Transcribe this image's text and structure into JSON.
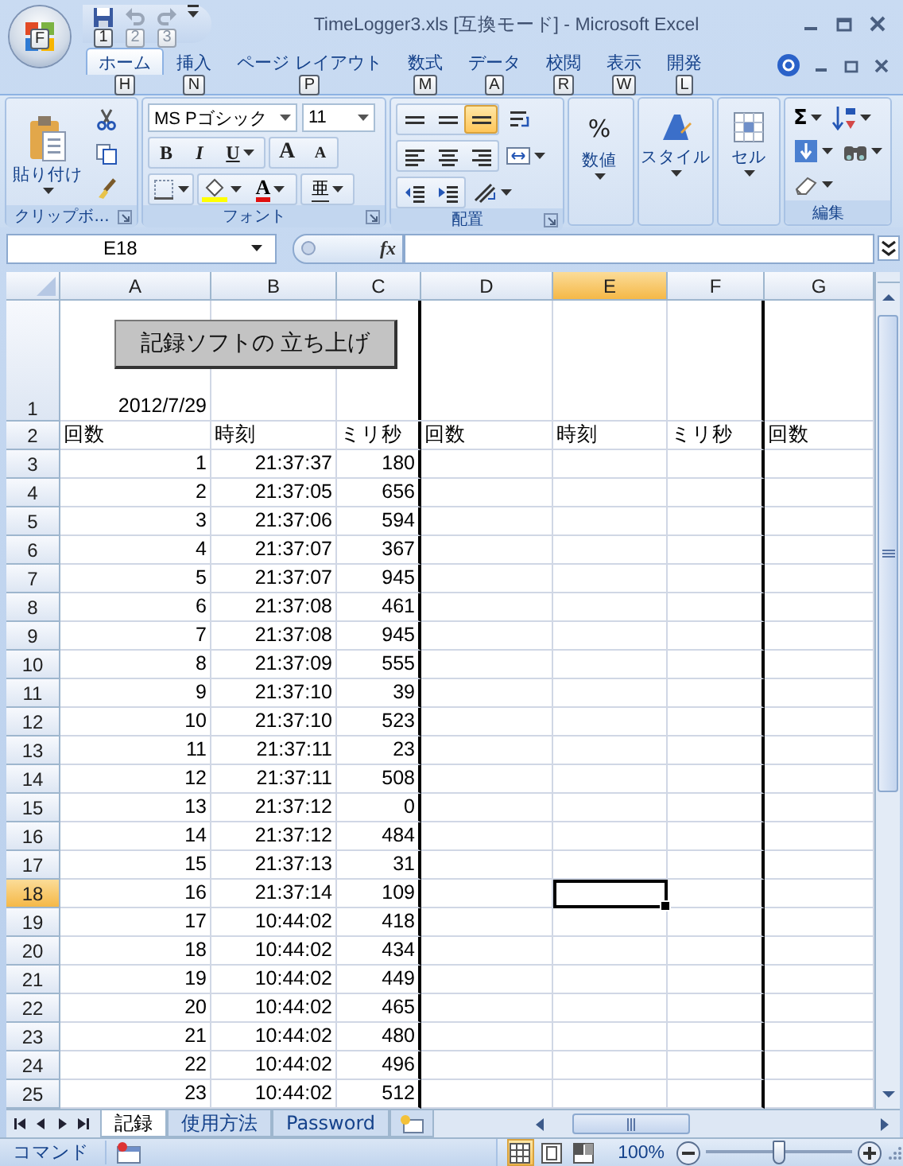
{
  "window": {
    "title": "TimeLogger3.xls  [互換モード] - Microsoft Excel",
    "office_keytip": "F",
    "quick_access": [
      {
        "kind": "save",
        "keytip": "1",
        "disabled": false
      },
      {
        "kind": "undo",
        "keytip": "2",
        "disabled": true
      },
      {
        "kind": "redo",
        "keytip": "3",
        "disabled": true
      }
    ]
  },
  "tabs": [
    {
      "label": "ホーム",
      "keytip": "H",
      "selected": true
    },
    {
      "label": "挿入",
      "keytip": "N",
      "selected": false
    },
    {
      "label": "ページ レイアウト",
      "keytip": "P",
      "selected": false
    },
    {
      "label": "数式",
      "keytip": "M",
      "selected": false
    },
    {
      "label": "データ",
      "keytip": "A",
      "selected": false
    },
    {
      "label": "校閲",
      "keytip": "R",
      "selected": false
    },
    {
      "label": "表示",
      "keytip": "W",
      "selected": false
    },
    {
      "label": "開発",
      "keytip": "L",
      "selected": false
    }
  ],
  "ribbon": {
    "groups": [
      {
        "kind": "clipboard",
        "label": "クリップボ...",
        "launcher": true,
        "paste_label": "貼り付け"
      },
      {
        "kind": "font",
        "label": "フォント",
        "launcher": true,
        "font_name": "MS Pゴシック",
        "font_size": "11",
        "bold": "B",
        "italic": "I",
        "underline": "U",
        "grow": "A",
        "shrink": "A",
        "font_color": "A",
        "phonetic": "亜"
      },
      {
        "kind": "alignment",
        "label": "配置",
        "launcher": true,
        "vertical_align": [
          {
            "selected": false
          },
          {
            "selected": false
          },
          {
            "selected": true
          }
        ]
      },
      {
        "kind": "number",
        "label": "数値",
        "launcher": false,
        "symbol": "%"
      },
      {
        "kind": "styles",
        "label": "スタイル",
        "launcher": false
      },
      {
        "kind": "cells",
        "label": "セル",
        "launcher": false
      },
      {
        "kind": "editing",
        "label": "編集",
        "launcher": false,
        "sum": "Σ"
      }
    ]
  },
  "formula_bar": {
    "name_box": "E18",
    "fx": "fx"
  },
  "sheet": {
    "button": "記録ソフトの 立ち上げ",
    "columns": [
      {
        "label": "A",
        "selected": false,
        "thick_right_border": false
      },
      {
        "label": "B",
        "selected": false,
        "thick_right_border": false
      },
      {
        "label": "C",
        "selected": false,
        "thick_right_border": true
      },
      {
        "label": "D",
        "selected": false,
        "thick_right_border": false
      },
      {
        "label": "E",
        "selected": true,
        "thick_right_border": false
      },
      {
        "label": "F",
        "selected": false,
        "thick_right_border": true
      },
      {
        "label": "G",
        "selected": false,
        "thick_right_border": false
      }
    ],
    "rows": [
      {
        "number": "1",
        "kind": "date",
        "selected": false,
        "cells": [
          "2012/7/29"
        ]
      },
      {
        "number": "2",
        "kind": "header",
        "selected": false,
        "cells": [
          "回数",
          "時刻",
          "ミリ秒",
          "回数",
          "時刻",
          "ミリ秒",
          "回数"
        ]
      },
      {
        "number": "3",
        "kind": "data",
        "selected": false,
        "cells": [
          "1",
          "21:37:37",
          "180"
        ]
      },
      {
        "number": "4",
        "kind": "data",
        "selected": false,
        "cells": [
          "2",
          "21:37:05",
          "656"
        ]
      },
      {
        "number": "5",
        "kind": "data",
        "selected": false,
        "cells": [
          "3",
          "21:37:06",
          "594"
        ]
      },
      {
        "number": "6",
        "kind": "data",
        "selected": false,
        "cells": [
          "4",
          "21:37:07",
          "367"
        ]
      },
      {
        "number": "7",
        "kind": "data",
        "selected": false,
        "cells": [
          "5",
          "21:37:07",
          "945"
        ]
      },
      {
        "number": "8",
        "kind": "data",
        "selected": false,
        "cells": [
          "6",
          "21:37:08",
          "461"
        ]
      },
      {
        "number": "9",
        "kind": "data",
        "selected": false,
        "cells": [
          "7",
          "21:37:08",
          "945"
        ]
      },
      {
        "number": "10",
        "kind": "data",
        "selected": false,
        "cells": [
          "8",
          "21:37:09",
          "555"
        ]
      },
      {
        "number": "11",
        "kind": "data",
        "selected": false,
        "cells": [
          "9",
          "21:37:10",
          "39"
        ]
      },
      {
        "number": "12",
        "kind": "data",
        "selected": false,
        "cells": [
          "10",
          "21:37:10",
          "523"
        ]
      },
      {
        "number": "13",
        "kind": "data",
        "selected": false,
        "cells": [
          "11",
          "21:37:11",
          "23"
        ]
      },
      {
        "number": "14",
        "kind": "data",
        "selected": false,
        "cells": [
          "12",
          "21:37:11",
          "508"
        ]
      },
      {
        "number": "15",
        "kind": "data",
        "selected": false,
        "cells": [
          "13",
          "21:37:12",
          "0"
        ]
      },
      {
        "number": "16",
        "kind": "data",
        "selected": false,
        "cells": [
          "14",
          "21:37:12",
          "484"
        ]
      },
      {
        "number": "17",
        "kind": "data",
        "selected": false,
        "cells": [
          "15",
          "21:37:13",
          "31"
        ]
      },
      {
        "number": "18",
        "kind": "data",
        "selected": true,
        "cells": [
          "16",
          "21:37:14",
          "109"
        ]
      },
      {
        "number": "19",
        "kind": "data",
        "selected": false,
        "cells": [
          "17",
          "10:44:02",
          "418"
        ]
      },
      {
        "number": "20",
        "kind": "data",
        "selected": false,
        "cells": [
          "18",
          "10:44:02",
          "434"
        ]
      },
      {
        "number": "21",
        "kind": "data",
        "selected": false,
        "cells": [
          "19",
          "10:44:02",
          "449"
        ]
      },
      {
        "number": "22",
        "kind": "data",
        "selected": false,
        "cells": [
          "20",
          "10:44:02",
          "465"
        ]
      },
      {
        "number": "23",
        "kind": "data",
        "selected": false,
        "cells": [
          "21",
          "10:44:02",
          "480"
        ]
      },
      {
        "number": "24",
        "kind": "data",
        "selected": false,
        "cells": [
          "22",
          "10:44:02",
          "496"
        ]
      },
      {
        "number": "25",
        "kind": "data",
        "selected": false,
        "cells": [
          "23",
          "10:44:02",
          "512"
        ]
      }
    ]
  },
  "sheet_tabs": [
    {
      "label": "記録",
      "selected": true
    },
    {
      "label": "使用方法",
      "selected": false
    },
    {
      "label": "Password",
      "selected": false
    }
  ],
  "status_bar": {
    "mode": "コマンド",
    "views": [
      {
        "kind": "normal",
        "selected": true
      },
      {
        "kind": "page_layout",
        "selected": false
      },
      {
        "kind": "page_break",
        "selected": false
      }
    ],
    "zoom": "100%",
    "zoom_slider": {
      "level": 0.5
    }
  }
}
